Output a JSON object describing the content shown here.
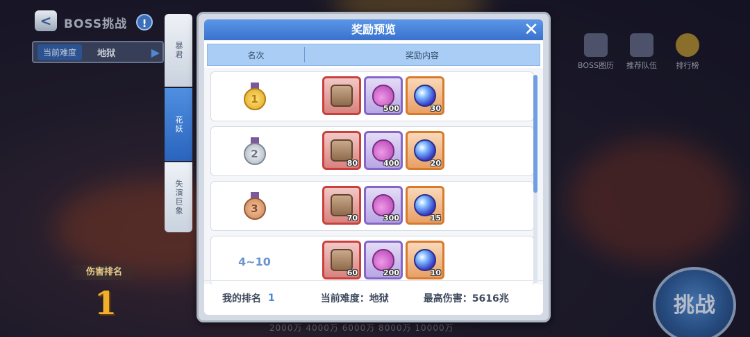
{
  "page": {
    "title": "BOSS挑战",
    "info_icon": "!",
    "back_icon": "<",
    "difficulty_label": "当前难度",
    "difficulty_value": "地狱"
  },
  "boss_tabs": [
    "暴君",
    "花妖",
    "失演巨象"
  ],
  "ranking": {
    "heading": "伤害排名",
    "value": "1"
  },
  "damage_scale": "2000万  4000万  6000万  8000万  10000万",
  "side_icons": [
    {
      "label": "BOSS图历",
      "icon": "book-icon"
    },
    {
      "label": "推荐队伍",
      "icon": "team-icon"
    },
    {
      "label": "排行榜",
      "icon": "trophy-icon"
    }
  ],
  "challenge_button": "挑战",
  "modal": {
    "title": "奖励预览",
    "close_icon": "✕",
    "col_rank": "名次",
    "col_content": "奖励内容",
    "rows": [
      {
        "rank": "1",
        "medal": "gold",
        "items": [
          {
            "rarity": "red",
            "kind": "box",
            "qty": ""
          },
          {
            "rarity": "purple",
            "kind": "potion",
            "qty": "500"
          },
          {
            "rarity": "orange",
            "kind": "orb",
            "qty": "30"
          }
        ]
      },
      {
        "rank": "2",
        "medal": "silver",
        "items": [
          {
            "rarity": "red",
            "kind": "box",
            "qty": "80"
          },
          {
            "rarity": "purple",
            "kind": "potion",
            "qty": "400"
          },
          {
            "rarity": "orange",
            "kind": "orb",
            "qty": "20"
          }
        ]
      },
      {
        "rank": "3",
        "medal": "bronze",
        "items": [
          {
            "rarity": "red",
            "kind": "box",
            "qty": "70"
          },
          {
            "rarity": "purple",
            "kind": "potion",
            "qty": "300"
          },
          {
            "rarity": "orange",
            "kind": "orb",
            "qty": "15"
          }
        ]
      },
      {
        "rank": "4~10",
        "medal": "",
        "items": [
          {
            "rarity": "red",
            "kind": "box",
            "qty": "60"
          },
          {
            "rarity": "purple",
            "kind": "potion",
            "qty": "200"
          },
          {
            "rarity": "orange",
            "kind": "orb",
            "qty": "10"
          }
        ]
      }
    ],
    "footer": {
      "my_rank_label": "我的排名",
      "my_rank_value": "1",
      "current_difficulty": "当前难度：地狱",
      "max_damage": "最高伤害：5616兆"
    }
  }
}
